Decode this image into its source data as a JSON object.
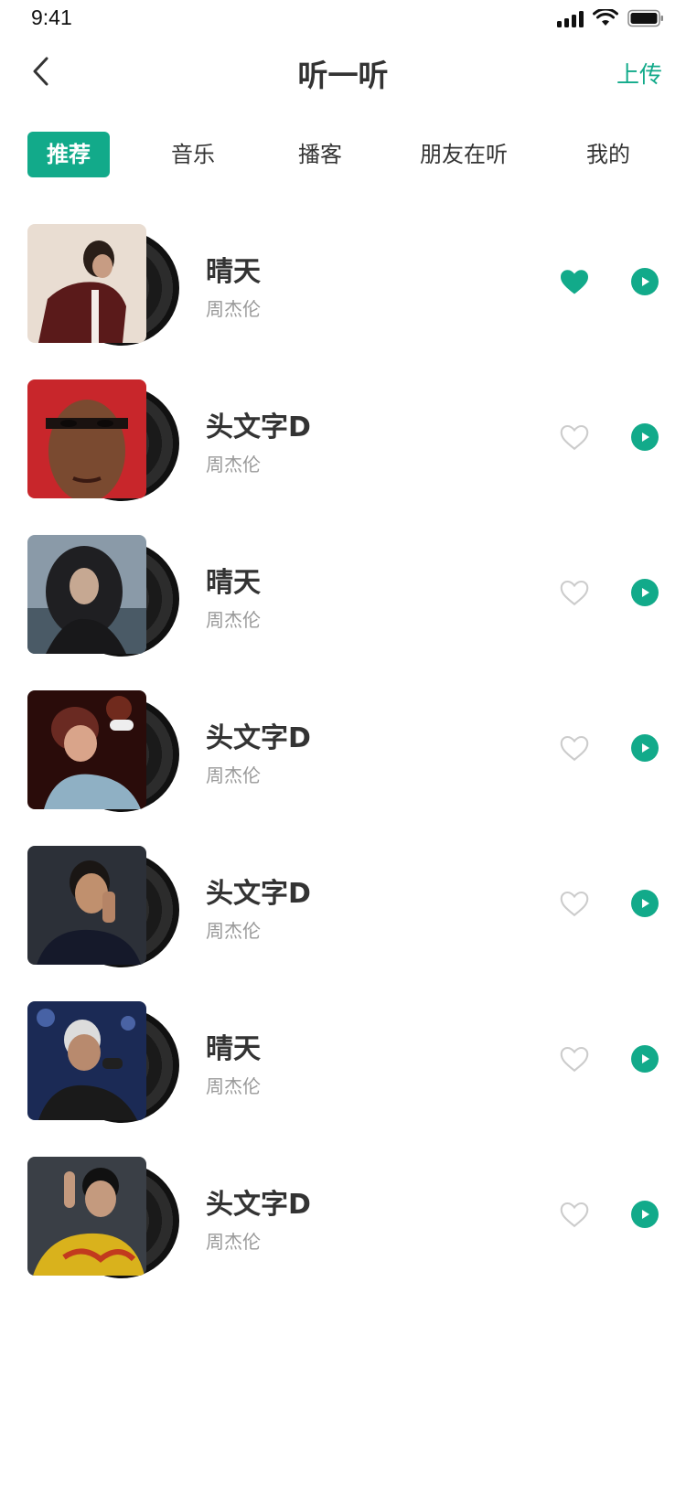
{
  "status_bar": {
    "time": "9:41"
  },
  "header": {
    "title": "听一听",
    "upload_label": "上传"
  },
  "tabs": [
    {
      "label": "推荐",
      "active": true
    },
    {
      "label": "音乐",
      "active": false
    },
    {
      "label": "播客",
      "active": false
    },
    {
      "label": "朋友在听",
      "active": false
    },
    {
      "label": "我的",
      "active": false
    }
  ],
  "songs": [
    {
      "title": "晴天",
      "artist": "周杰伦",
      "liked": true
    },
    {
      "title": "头文字D",
      "artist": "周杰伦",
      "liked": false
    },
    {
      "title": "晴天",
      "artist": "周杰伦",
      "liked": false
    },
    {
      "title": "头文字D",
      "artist": "周杰伦",
      "liked": false
    },
    {
      "title": "头文字D",
      "artist": "周杰伦",
      "liked": false
    },
    {
      "title": "晴天",
      "artist": "周杰伦",
      "liked": false
    },
    {
      "title": "头文字D",
      "artist": "周杰伦",
      "liked": false
    }
  ],
  "icons": {
    "back": "chevron-left-icon",
    "like": "heart-icon",
    "play": "play-icon",
    "signal": "signal-icon",
    "wifi": "wifi-icon",
    "battery": "battery-icon"
  },
  "colors": {
    "accent": "#12AA8A",
    "title": "#333333",
    "subtitle": "#999999",
    "heart_inactive": "#CCCCCC"
  }
}
